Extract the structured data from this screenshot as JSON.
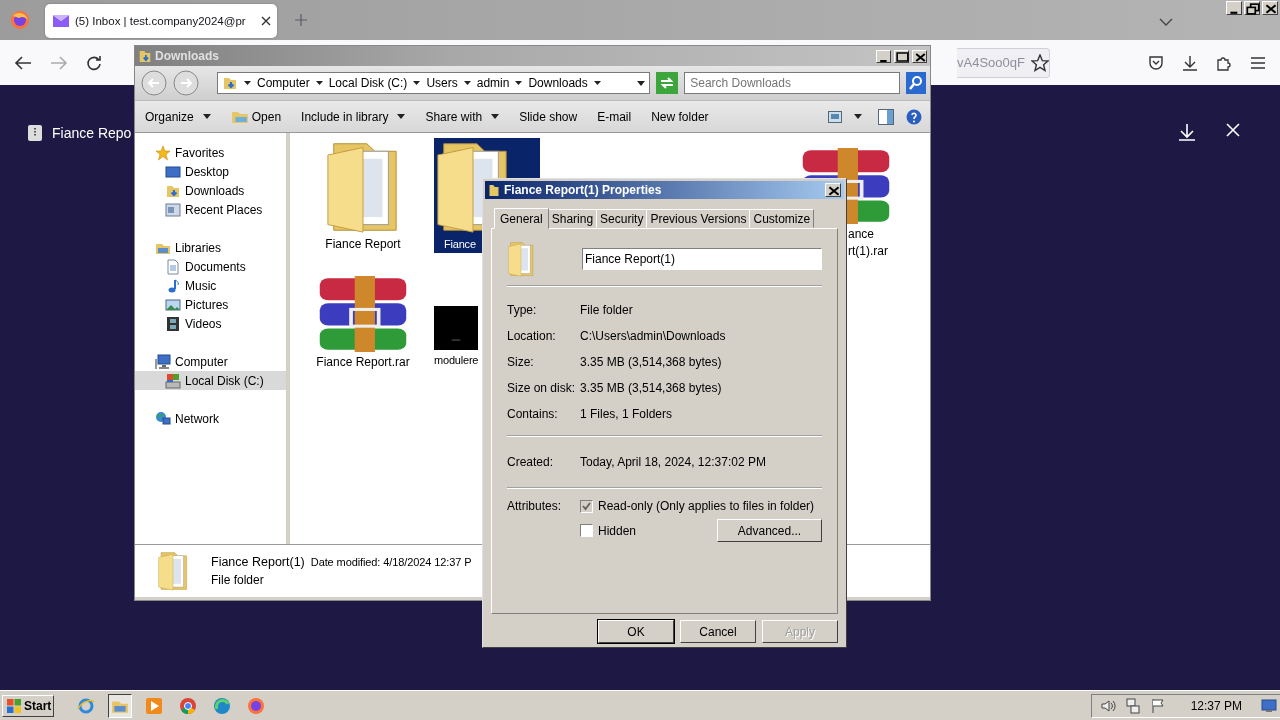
{
  "browser": {
    "tabs": [
      {
        "title": "(5) Inbox | test.company2024@pr",
        "selected": true
      }
    ],
    "url_fragment": "vA4Soo0qF",
    "viewer": {
      "file_name": "Fiance Repo"
    }
  },
  "explorer": {
    "title": "Downloads",
    "breadcrumb": [
      "Computer",
      "Local Disk (C:)",
      "Users",
      "admin",
      "Downloads"
    ],
    "search_placeholder": "Search Downloads",
    "toolbar": [
      {
        "label": "Organize",
        "kind": "menu"
      },
      {
        "label": "Open",
        "kind": "icon"
      },
      {
        "label": "Include in library",
        "kind": "menu"
      },
      {
        "label": "Share with",
        "kind": "menu"
      },
      {
        "label": "Slide show",
        "kind": "plain"
      },
      {
        "label": "E-mail",
        "kind": "plain"
      },
      {
        "label": "New folder",
        "kind": "plain"
      }
    ],
    "nav": [
      {
        "label": "Favorites",
        "kind": "star",
        "selected": false,
        "children": [
          {
            "label": "Desktop",
            "kind": "desktop",
            "selected": false
          },
          {
            "label": "Downloads",
            "kind": "downloads",
            "selected": false
          },
          {
            "label": "Recent Places",
            "kind": "recent",
            "selected": false
          }
        ]
      },
      {
        "label": "Libraries",
        "kind": "library",
        "selected": false,
        "children": [
          {
            "label": "Documents",
            "kind": "documents",
            "selected": false
          },
          {
            "label": "Music",
            "kind": "music",
            "selected": false
          },
          {
            "label": "Pictures",
            "kind": "pictures",
            "selected": false
          },
          {
            "label": "Videos",
            "kind": "videos",
            "selected": false
          }
        ]
      },
      {
        "label": "Computer",
        "kind": "computer",
        "selected": false,
        "children": [
          {
            "label": "Local Disk (C:)",
            "kind": "disk",
            "selected": true
          }
        ]
      },
      {
        "label": "Network",
        "kind": "network",
        "selected": false
      }
    ],
    "items": [
      {
        "label": [
          "Fiance Report"
        ],
        "kind": "folder",
        "selected": false
      },
      {
        "label": [
          "Fiance"
        ],
        "kind": "folder",
        "selected": true
      },
      {
        "label": [
          "ance",
          "rt(1).rar"
        ],
        "kind": "rar",
        "selected": false
      },
      {
        "label": [
          "Fiance Report.rar"
        ],
        "kind": "rar",
        "selected": false
      },
      {
        "label": [
          "modulere"
        ],
        "kind": "video",
        "selected": false
      }
    ],
    "details": {
      "name": "Fiance Report(1)",
      "modified": "Date modified: 4/18/2024 12:37 P",
      "type": "File folder"
    }
  },
  "dialog": {
    "title": "Fiance Report(1) Properties",
    "tabs": [
      {
        "label": "General",
        "selected": true
      },
      {
        "label": "Sharing",
        "selected": false
      },
      {
        "label": "Security",
        "selected": false
      },
      {
        "label": "Previous Versions",
        "selected": false
      },
      {
        "label": "Customize",
        "selected": false
      }
    ],
    "name_value": "Fiance Report(1)",
    "groups": [
      [
        {
          "label": "Type:",
          "value": "File folder"
        },
        {
          "label": "Location:",
          "value": "C:\\Users\\admin\\Downloads"
        },
        {
          "label": "Size:",
          "value": "3.35 MB (3,514,368 bytes)"
        },
        {
          "label": "Size on disk:",
          "value": "3.35 MB (3,514,368 bytes)"
        },
        {
          "label": "Contains:",
          "value": "1 Files, 1 Folders"
        }
      ],
      [
        {
          "label": "Created:",
          "value": "Today, April 18, 2024, 12:37:02 PM"
        }
      ]
    ],
    "attributes_label": "Attributes:",
    "attributes": [
      {
        "label": "Read-only (Only applies to files in folder)",
        "checked": true
      },
      {
        "label": "Hidden",
        "checked": false
      }
    ],
    "advanced": "Advanced...",
    "buttons": [
      {
        "label": "OK",
        "disabled": false
      },
      {
        "label": "Cancel",
        "disabled": false
      },
      {
        "label": "Apply",
        "disabled": true
      }
    ]
  },
  "taskbar": {
    "start": "Start",
    "apps": [
      {
        "kind": "ie",
        "active": false
      },
      {
        "kind": "explorer",
        "active": true
      },
      {
        "kind": "media",
        "active": false
      },
      {
        "kind": "chrome",
        "active": false
      },
      {
        "kind": "edge",
        "active": false
      },
      {
        "kind": "firefox",
        "active": false
      }
    ],
    "clock": "12:37 PM"
  }
}
